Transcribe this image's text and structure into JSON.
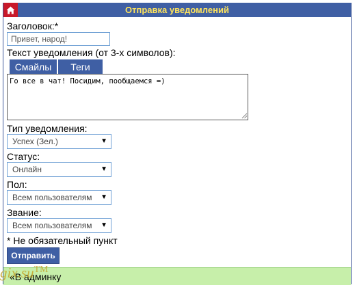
{
  "title": "Отправка уведомлений",
  "home_icon": "home-icon",
  "colors": {
    "header_bg": "#3f5fa4",
    "header_text": "#ffe45c",
    "home_button": "#c8192a",
    "input_border": "#6d9fd4",
    "footer_bg": "#c7efaa"
  },
  "form": {
    "header_label": "Заголовок:*",
    "header_value": "Привет, народ!",
    "text_label": "Текст уведомления (от 3-х символов):",
    "tabs": [
      "Смайлы",
      "Теги"
    ],
    "text_value": "Го все в чат! Посидим, пообщаемся =)",
    "type_label": "Тип уведомления:",
    "type_value": "Успех (Зел.)",
    "status_label": "Статус:",
    "status_value": "Онлайн",
    "gender_label": "Пол:",
    "gender_value": "Всем пользователям",
    "rank_label": "Звание:",
    "rank_value": "Всем пользователям",
    "optional_note": "* Не обязательный пункт",
    "submit_label": "Отправить"
  },
  "footer": {
    "back_label": "«В админку"
  },
  "watermark": {
    "text": "gix.su",
    "tm": "TM"
  }
}
